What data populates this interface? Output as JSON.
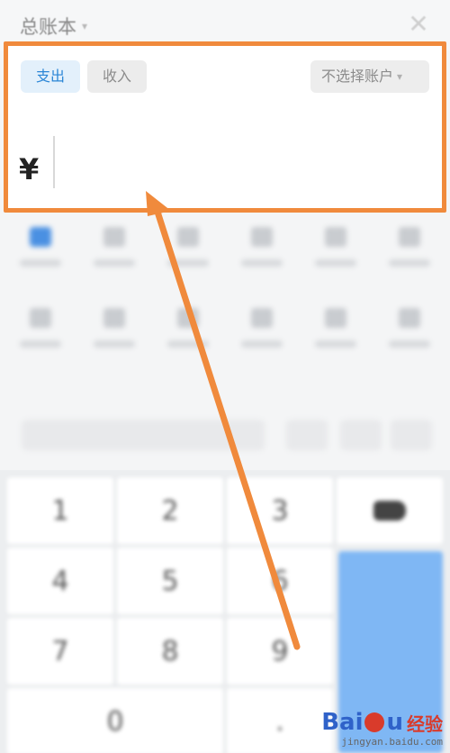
{
  "header": {
    "book_title": "总账本",
    "book_caret": "▾",
    "close_glyph": "✕"
  },
  "entry": {
    "tabs": [
      {
        "label": "支出",
        "selected": true
      },
      {
        "label": "收入",
        "selected": false
      }
    ],
    "account_select": {
      "label": "不选择账户",
      "caret": "▾"
    },
    "currency_symbol": "¥",
    "amount": ""
  },
  "keypad": {
    "keys": [
      "1",
      "2",
      "3",
      "4",
      "5",
      "6",
      "7",
      "8",
      "9",
      "0",
      "."
    ],
    "backspace_icon": "backspace-icon"
  },
  "colors": {
    "highlight_border": "#f08a3c",
    "arrow": "#f08a3c",
    "accent_blue": "#2b86d6",
    "done_key": "#7fb7f4"
  },
  "watermark": {
    "brand": "Bai",
    "brand_tail": "u",
    "cn": "经验",
    "url": "jingyan.baidu.com"
  }
}
